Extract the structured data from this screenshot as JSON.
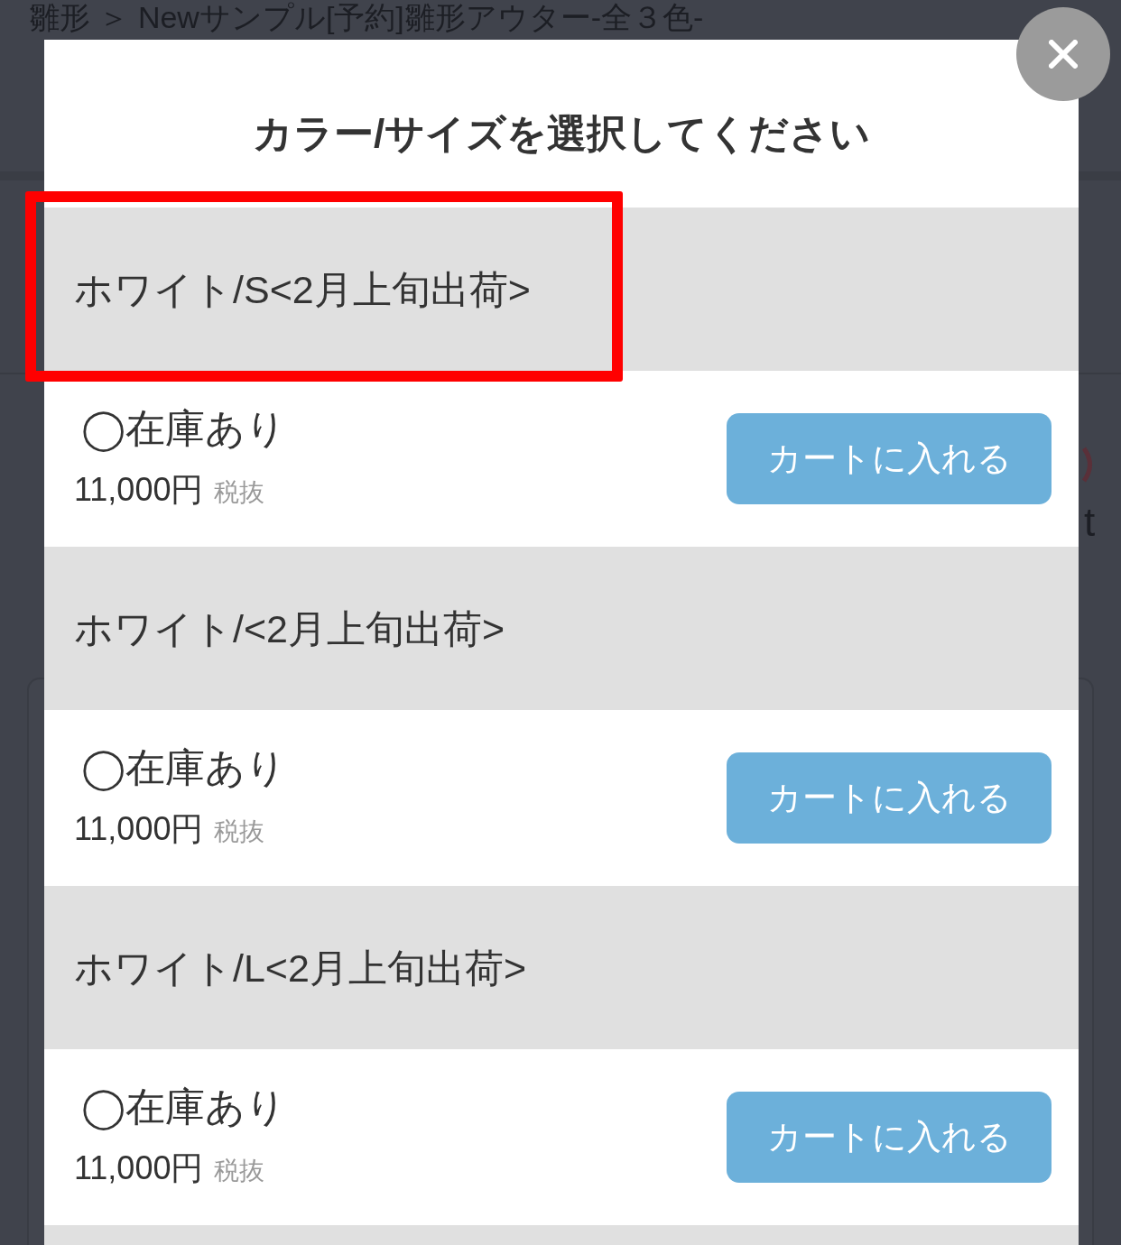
{
  "background_page": {
    "breadcrumb": "雛形 ＞ Newサンプル[予約]雛形アウター-全３色-",
    "text_fragment": "t"
  },
  "modal": {
    "title": "カラー/サイズを選択してください",
    "variants": [
      {
        "label": "ホワイト/S<2月上旬出荷>",
        "highlighted": true,
        "stock": "◯在庫あり",
        "price": "11,000円",
        "tax_note": "税抜",
        "button": "カートに入れる"
      },
      {
        "label": "ホワイト/<2月上旬出荷>",
        "highlighted": false,
        "stock": "◯在庫あり",
        "price": "11,000円",
        "tax_note": "税抜",
        "button": "カートに入れる"
      },
      {
        "label": "ホワイト/L<2月上旬出荷>",
        "highlighted": false,
        "stock": "◯在庫あり",
        "price": "11,000円",
        "tax_note": "税抜",
        "button": "カートに入れる"
      }
    ]
  }
}
